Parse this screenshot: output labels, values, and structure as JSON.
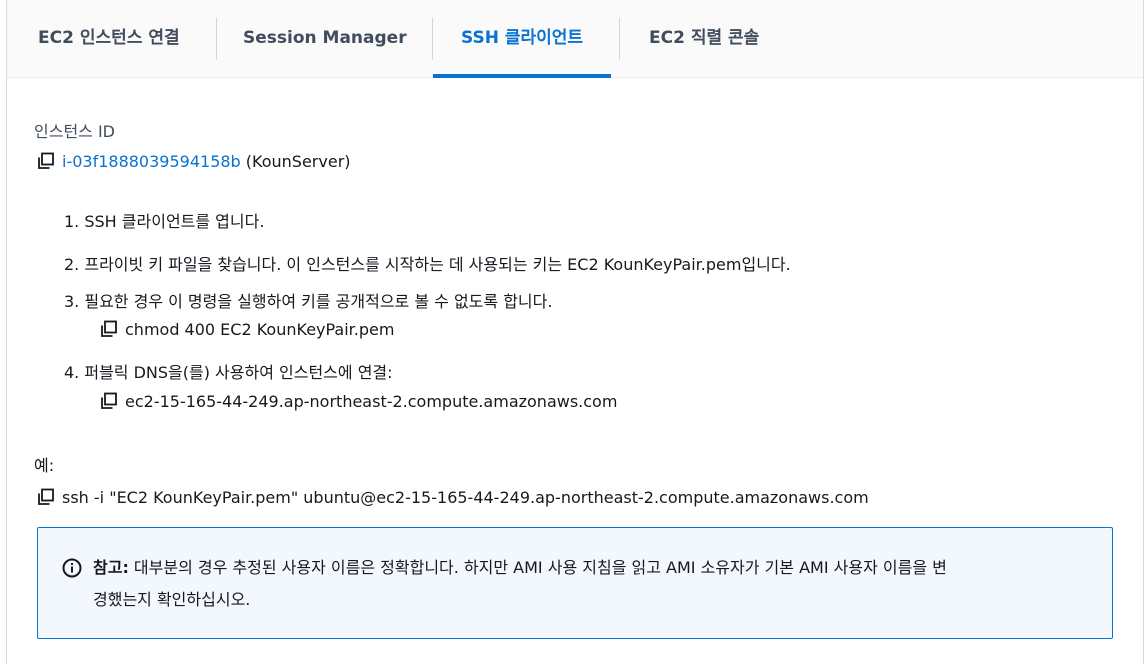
{
  "tabs": [
    {
      "label": "EC2 인스턴스 연결",
      "active": false
    },
    {
      "label": "Session Manager",
      "active": false
    },
    {
      "label": "SSH 클라이언트",
      "active": true
    },
    {
      "label": "EC2 직렬 콘솔",
      "active": false
    }
  ],
  "instance": {
    "label": "인스턴스 ID",
    "id": "i-03f1888039594158b",
    "name": "(KounServer)"
  },
  "steps": [
    {
      "text": "1. SSH 클라이언트를 엽니다."
    },
    {
      "text": "2. 프라이빗 키 파일을 찾습니다. 이 인스턴스를 시작하는 데 사용되는 키는 EC2 KounKeyPair.pem입니다."
    },
    {
      "text": "3. 필요한 경우 이 명령을 실행하여 키를 공개적으로 볼 수 없도록 합니다.",
      "code": "chmod 400 EC2 KounKeyPair.pem"
    },
    {
      "text": "4. 퍼블릭 DNS을(를) 사용하여 인스턴스에 연결:",
      "code": "ec2-15-165-44-249.ap-northeast-2.compute.amazonaws.com"
    }
  ],
  "example": {
    "label": "예:",
    "command": "ssh -i \"EC2 KounKeyPair.pem\" ubuntu@ec2-15-165-44-249.ap-northeast-2.compute.amazonaws.com"
  },
  "notice": {
    "title": "참고:",
    "line1": " 대부분의 경우 추정된 사용자 이름은 정확합니다. 하지만 AMI 사용 지침을 읽고 AMI 소유자가 기본 AMI 사용자 이름을 변",
    "line2": "경했는지 확인하십시오."
  },
  "colors": {
    "accent": "#0972d3",
    "text": "#16191f",
    "notice_bg": "#f2f8fd"
  },
  "icons": {
    "copy": "copy-icon",
    "info": "info-icon"
  }
}
